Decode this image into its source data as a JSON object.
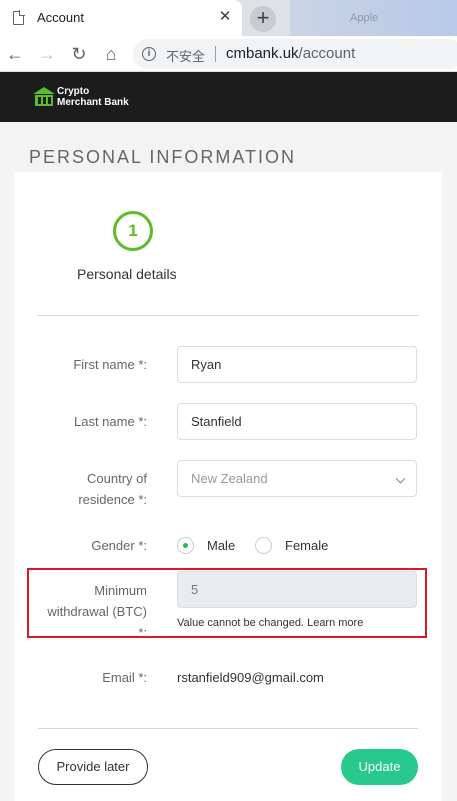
{
  "browser": {
    "tab_title": "Account",
    "other_tab_title": "Apple",
    "security_label": "不安全",
    "url_host": "cmbank.uk",
    "url_path": "/account"
  },
  "site": {
    "brand_line1": "Crypto",
    "brand_line2": "Merchant Bank"
  },
  "page": {
    "title": "PERSONAL INFORMATION",
    "step_number": "1",
    "step_label": "Personal details"
  },
  "form": {
    "first_name": {
      "label": "First name *:",
      "value": "Ryan"
    },
    "last_name": {
      "label": "Last name *:",
      "value": "Stanfield"
    },
    "country": {
      "label_line1": "Country of",
      "label_line2": "residence *:",
      "value": "New Zealand"
    },
    "gender": {
      "label": "Gender *:",
      "options": [
        "Male",
        "Female"
      ],
      "selected": "Male"
    },
    "min_withdrawal": {
      "label_line1": "Minimum",
      "label_line2": "withdrawal (BTC)",
      "label_line3": "*:",
      "value": "5",
      "hint": "Value cannot be changed.",
      "hint_link": "Learn more"
    },
    "email": {
      "label": "Email *:",
      "value": "rstanfield909@gmail.com"
    }
  },
  "actions": {
    "provide_later": "Provide later",
    "update": "Update"
  },
  "colors": {
    "accent_green": "#5cbc2a",
    "update_button": "#27c98d",
    "highlight_border": "#d9182a"
  }
}
